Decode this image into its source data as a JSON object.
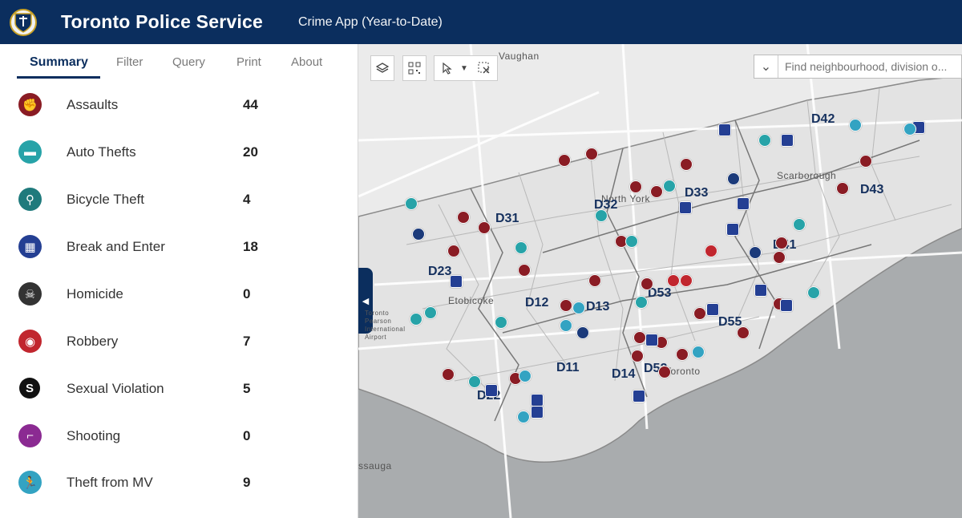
{
  "header": {
    "title": "Toronto Police Service",
    "subtitle": "Crime App (Year-to-Date)"
  },
  "tabs": [
    {
      "label": "Summary"
    },
    {
      "label": "Filter"
    },
    {
      "label": "Query"
    },
    {
      "label": "Print"
    },
    {
      "label": "About"
    }
  ],
  "crimes": [
    {
      "label": "Assaults",
      "count": "44",
      "icon": "assault-icon",
      "color": "#8a1c24"
    },
    {
      "label": "Auto Thefts",
      "count": "20",
      "icon": "auto-theft-icon",
      "color": "#27a3a8"
    },
    {
      "label": "Bicycle Theft",
      "count": "4",
      "icon": "bicycle-icon",
      "color": "#1f7a7c"
    },
    {
      "label": "Break and Enter",
      "count": "18",
      "icon": "window-icon",
      "color": "#243f93"
    },
    {
      "label": "Homicide",
      "count": "0",
      "icon": "homicide-icon",
      "color": "#333333"
    },
    {
      "label": "Robbery",
      "count": "7",
      "icon": "mask-icon",
      "color": "#c1262e"
    },
    {
      "label": "Sexual Violation",
      "count": "5",
      "icon": "s-icon",
      "color": "#111111"
    },
    {
      "label": "Shooting",
      "count": "0",
      "icon": "gun-icon",
      "color": "#8b2a92"
    },
    {
      "label": "Theft from MV",
      "count": "9",
      "icon": "runner-icon",
      "color": "#33a3c2"
    }
  ],
  "search": {
    "placeholder": "Find neighbourhood, division o..."
  },
  "map": {
    "places": [
      "Vaughan",
      "North York",
      "Scarborough",
      "Etobicoke",
      "Toronto Pearson International Airport",
      "Toronto",
      "ssauga"
    ],
    "divisions": [
      "D42",
      "D43",
      "D33",
      "D32",
      "D31",
      "D41",
      "D23",
      "D53",
      "D12",
      "D13",
      "D55",
      "D11",
      "D14",
      "D52",
      "D22"
    ]
  }
}
